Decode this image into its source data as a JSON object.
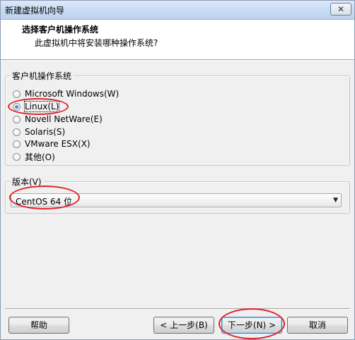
{
  "window": {
    "title": "新建虚拟机向导",
    "close_glyph": "✕"
  },
  "header": {
    "heading": "选择客户机操作系统",
    "subheading": "此虚拟机中将安装哪种操作系统?"
  },
  "os_group": {
    "legend": "客户机操作系统",
    "options": [
      {
        "label": "Microsoft Windows(W)",
        "checked": false
      },
      {
        "label": "Linux(L)",
        "checked": true
      },
      {
        "label": "Novell NetWare(E)",
        "checked": false
      },
      {
        "label": "Solaris(S)",
        "checked": false
      },
      {
        "label": "VMware ESX(X)",
        "checked": false
      },
      {
        "label": "其他(O)",
        "checked": false
      }
    ]
  },
  "version_group": {
    "legend": "版本(V)",
    "selected": "CentOS 64 位",
    "arrow_icon": "chevron-down-icon"
  },
  "buttons": {
    "help": "帮助",
    "back": "< 上一步(B)",
    "next": "下一步(N) >",
    "cancel": "取消"
  },
  "colors": {
    "annotation": "#e3202a",
    "radio_checked": "#1d5fb8",
    "default_button_border": "#3c7fb1"
  }
}
